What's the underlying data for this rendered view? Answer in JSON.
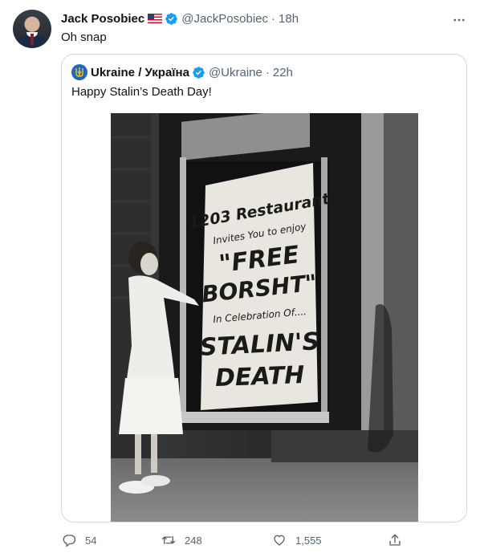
{
  "tweet": {
    "author": {
      "name": "Jack Posobiec",
      "handle": "@JackPosobiec",
      "time": "18h",
      "flag_icon": "us-flag-icon",
      "verified_icon": "verified-badge-icon"
    },
    "text": "Oh snap",
    "more_icon": "more-horizontal-icon"
  },
  "quoted_tweet": {
    "author": {
      "name": "Ukraine / Україна",
      "handle": "@Ukraine",
      "time": "22h",
      "avatar_icon": "ukraine-trident-icon",
      "verified_icon": "verified-badge-icon"
    },
    "text": "Happy Stalin’s Death Day!",
    "photo": {
      "sign_lines": [
        "1203 Restaurant",
        "Invites You to enjoy",
        "\"FREE",
        "BORSHT\"",
        "In Celebration Of....",
        "STALIN'S",
        "DEATH"
      ]
    }
  },
  "actions": {
    "replies": "54",
    "retweets": "248",
    "likes": "1,555",
    "reply_icon": "reply-icon",
    "retweet_icon": "retweet-icon",
    "like_icon": "heart-icon",
    "share_icon": "share-icon"
  },
  "colors": {
    "accent": "#1d9bf0",
    "secondary_text": "#536471",
    "border": "#cfd9de"
  },
  "separator": "·"
}
